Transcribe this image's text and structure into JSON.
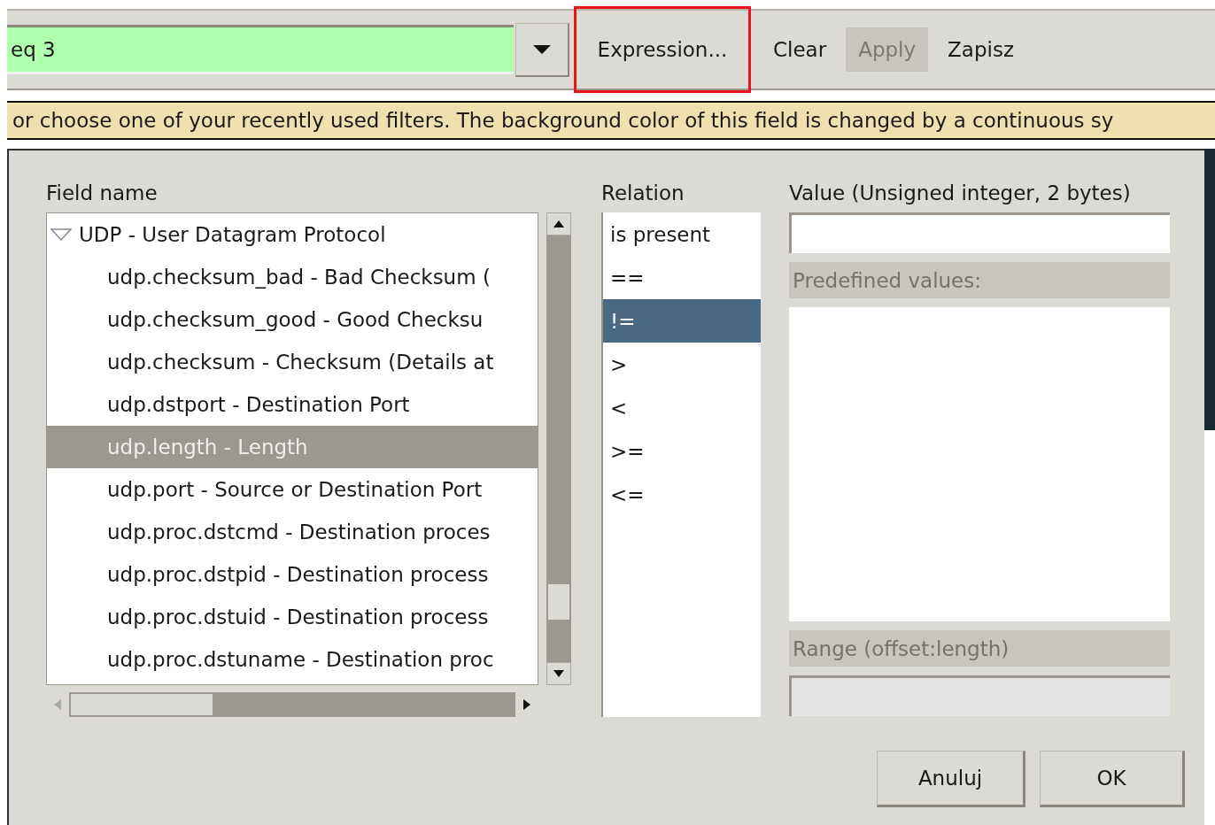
{
  "toolbar": {
    "filter": {
      "value": "eq 3",
      "valid": true
    },
    "buttons": [
      {
        "label": "Expression...",
        "disabled": false,
        "highlighted": true
      },
      {
        "label": "Clear",
        "disabled": false,
        "highlighted": false
      },
      {
        "label": "Apply",
        "disabled": true,
        "highlighted": false
      },
      {
        "label": "Zapisz",
        "disabled": false,
        "highlighted": false
      }
    ]
  },
  "tooltip": "or choose one of your recently used filters. The background color of this field is changed by a continuous sy",
  "dialog": {
    "field_name_label": "Field name",
    "tree": [
      {
        "label": "UDP - User Datagram Protocol",
        "expanded": true,
        "selected": false,
        "children": [
          {
            "label": "udp.checksum_bad - Bad Checksum (",
            "selected": false
          },
          {
            "label": "udp.checksum_good - Good Checksu",
            "selected": false
          },
          {
            "label": "udp.checksum - Checksum (Details at",
            "selected": false
          },
          {
            "label": "udp.dstport - Destination Port",
            "selected": false
          },
          {
            "label": "udp.length - Length",
            "selected": true
          },
          {
            "label": "udp.port - Source or Destination Port",
            "selected": false
          },
          {
            "label": "udp.proc.dstcmd - Destination proces",
            "selected": false
          },
          {
            "label": "udp.proc.dstpid - Destination process",
            "selected": false
          },
          {
            "label": "udp.proc.dstuid - Destination process",
            "selected": false
          },
          {
            "label": "udp.proc.dstuname - Destination proc",
            "selected": false
          }
        ]
      }
    ],
    "relation_label": "Relation",
    "relations": [
      {
        "label": "is present",
        "selected": false
      },
      {
        "label": "==",
        "selected": false
      },
      {
        "label": "!=",
        "selected": true
      },
      {
        "label": ">",
        "selected": false
      },
      {
        "label": "<",
        "selected": false
      },
      {
        "label": ">=",
        "selected": false
      },
      {
        "label": "<=",
        "selected": false
      }
    ],
    "value_label": "Value (Unsigned integer, 2 bytes)",
    "predefined_label": "Predefined values:",
    "range_label": "Range (offset:length)",
    "buttons": [
      "Anuluj",
      "OK"
    ]
  }
}
